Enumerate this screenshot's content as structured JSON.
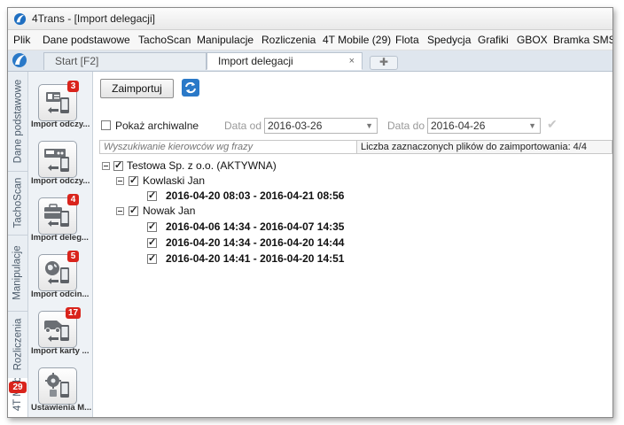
{
  "window": {
    "title": "4Trans - [Import delegacji]"
  },
  "menu": [
    "Plik",
    "Dane podstawowe",
    "TachoScan",
    "Manipulacje",
    "Rozliczenia",
    "4T Mobile (29)",
    "Flota",
    "Spedycja",
    "Grafiki",
    "GBOX",
    "Bramka SMS"
  ],
  "tabs": {
    "start": "Start [F2]",
    "active": "Import delegacji",
    "close_glyph": "×",
    "new_glyph": "✚"
  },
  "side_tabs": [
    {
      "label": "Dane podstawowe"
    },
    {
      "label": "TachoScan"
    },
    {
      "label": "Manipulacje"
    },
    {
      "label": "Rozliczenia"
    },
    {
      "label": "4T Mobile"
    }
  ],
  "side_tab_badge": "29",
  "icon_buttons": [
    {
      "label": "Import odczy...",
      "badge": "3",
      "icon": "card-reader-icon"
    },
    {
      "label": "Import odczy...",
      "badge": "",
      "icon": "tachograph-import-icon"
    },
    {
      "label": "Import deleg...",
      "badge": "4",
      "icon": "delegation-import-icon"
    },
    {
      "label": "Import odcin...",
      "badge": "5",
      "icon": "globe-import-icon"
    },
    {
      "label": "Import karty ...",
      "badge": "17",
      "icon": "vehicle-card-import-icon"
    },
    {
      "label": "Ustawienia M...",
      "badge": "",
      "icon": "settings-mobile-icon"
    }
  ],
  "toolbar": {
    "import_button": "Zaimportuj"
  },
  "filters": {
    "show_archived_label": "Pokaż archiwalne",
    "show_archived_checked": false,
    "date_from_label": "Data od",
    "date_from_value": "2016-03-26",
    "date_to_label": "Data do",
    "date_to_value": "2016-04-26"
  },
  "search": {
    "placeholder": "Wyszukiwanie kierowców wg frazy"
  },
  "selected_count_text": "Liczba zaznaczonych plików do zaimportowania: 4/4",
  "tree": {
    "company": "Testowa Sp. z o.o. (AKTYWNA)",
    "drivers": [
      {
        "name": "Kowlaski Jan",
        "entries": [
          "2016-04-20 08:03   -   2016-04-21 08:56"
        ]
      },
      {
        "name": "Nowak Jan",
        "entries": [
          "2016-04-06 14:34   -   2016-04-07 14:35",
          "2016-04-20 14:34   -   2016-04-20 14:44",
          "2016-04-20 14:41   -   2016-04-20 14:51"
        ]
      }
    ]
  },
  "colors": {
    "badge": "#d9241c",
    "accent": "#2a79c8"
  }
}
